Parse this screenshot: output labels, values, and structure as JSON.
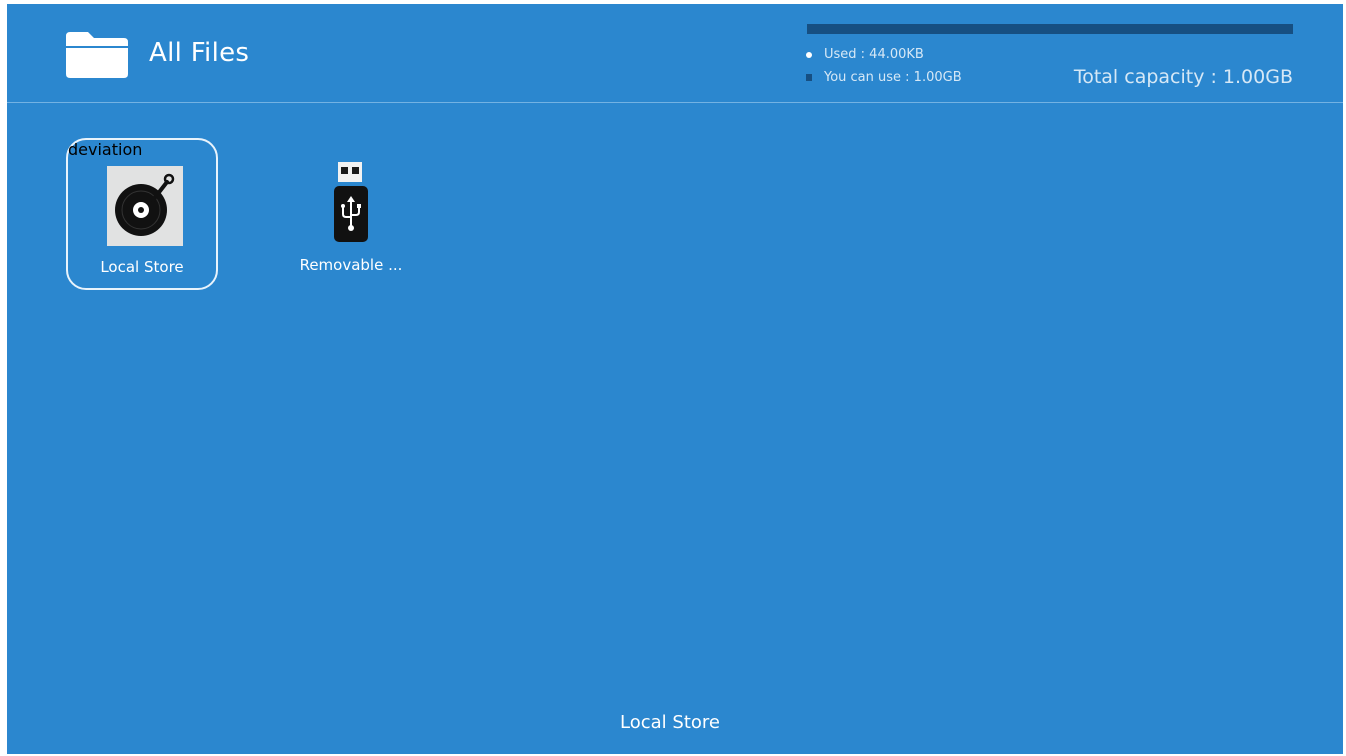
{
  "header": {
    "title": "All Files",
    "folder_icon": "folder-icon"
  },
  "storage": {
    "used_label": "Used : 44.00KB",
    "free_label": "You can use : 1.00GB",
    "total_label": "Total capacity : 1.00GB",
    "used_fraction": 0.0,
    "used_color": "#ffffff",
    "free_color": "#164f82"
  },
  "items": [
    {
      "label": "Local Store",
      "icon": "vinyl-disc-icon",
      "selected": true
    },
    {
      "label": "Removable ...",
      "icon": "usb-drive-icon",
      "selected": false
    }
  ],
  "status": {
    "current": "Local Store"
  },
  "colors": {
    "background": "#2b87cf",
    "text": "#ffffff",
    "focus_border": "#e8f3fc"
  }
}
